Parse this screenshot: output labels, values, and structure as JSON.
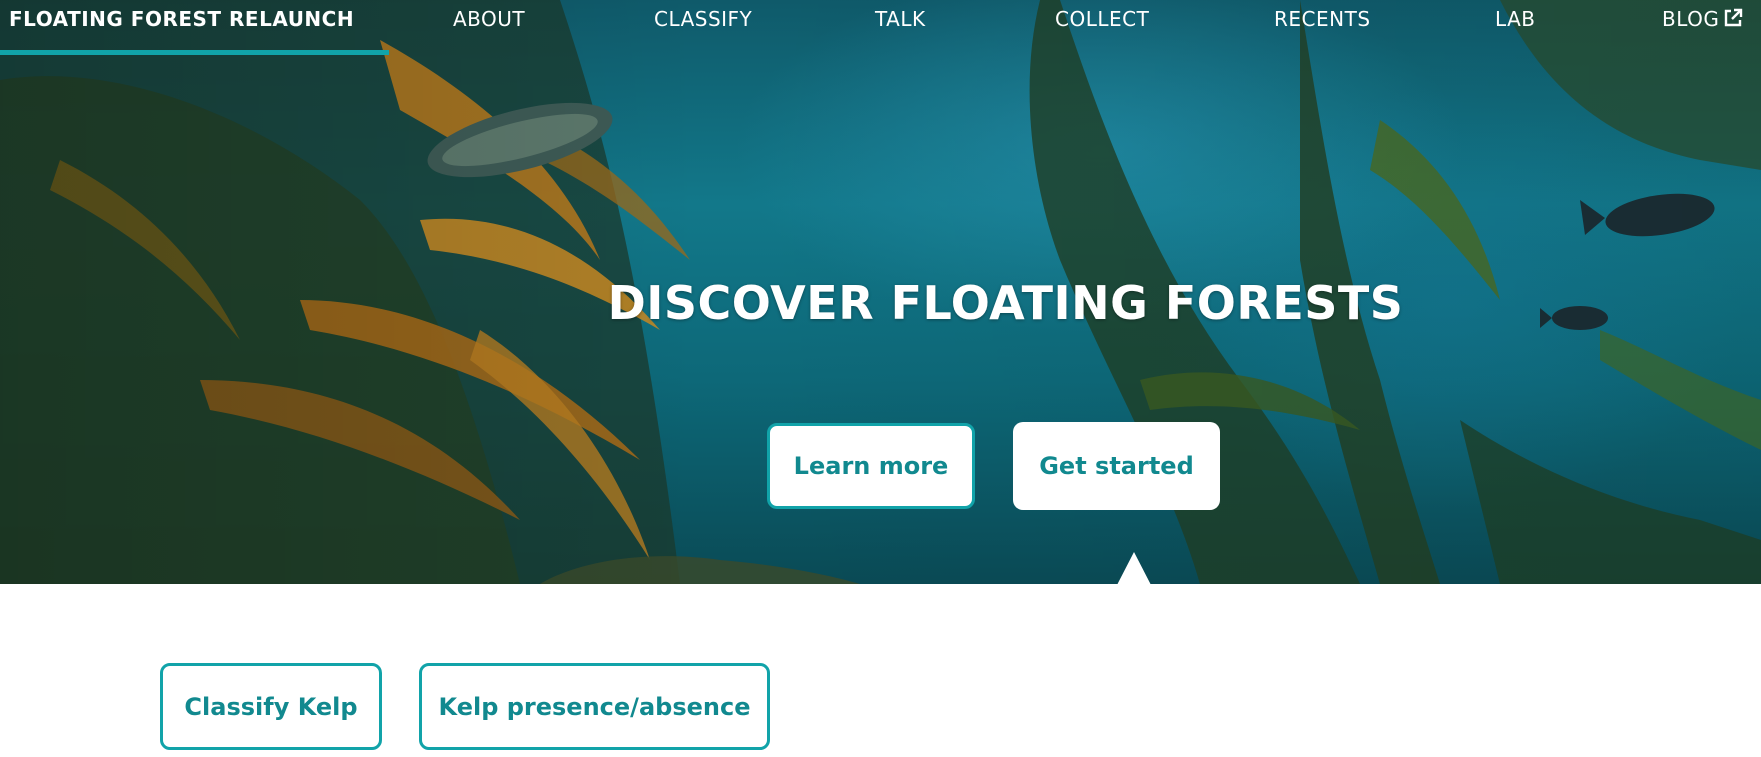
{
  "nav": {
    "brand": "FLOATING FOREST RELAUNCH",
    "links": [
      {
        "label": "ABOUT"
      },
      {
        "label": "CLASSIFY"
      },
      {
        "label": "TALK"
      },
      {
        "label": "COLLECT"
      },
      {
        "label": "RECENTS"
      },
      {
        "label": "LAB"
      },
      {
        "label": "BLOG",
        "icon": "external-link-icon"
      }
    ]
  },
  "hero": {
    "title": "DISCOVER FLOATING FORESTS",
    "learn_more_label": "Learn more",
    "get_started_label": "Get started"
  },
  "workflows": [
    {
      "label": "Classify Kelp"
    },
    {
      "label": "Kelp presence/absence"
    }
  ],
  "colors": {
    "accent": "#11a3a9",
    "button_text": "#11898f",
    "hero_water": "#12788a"
  }
}
